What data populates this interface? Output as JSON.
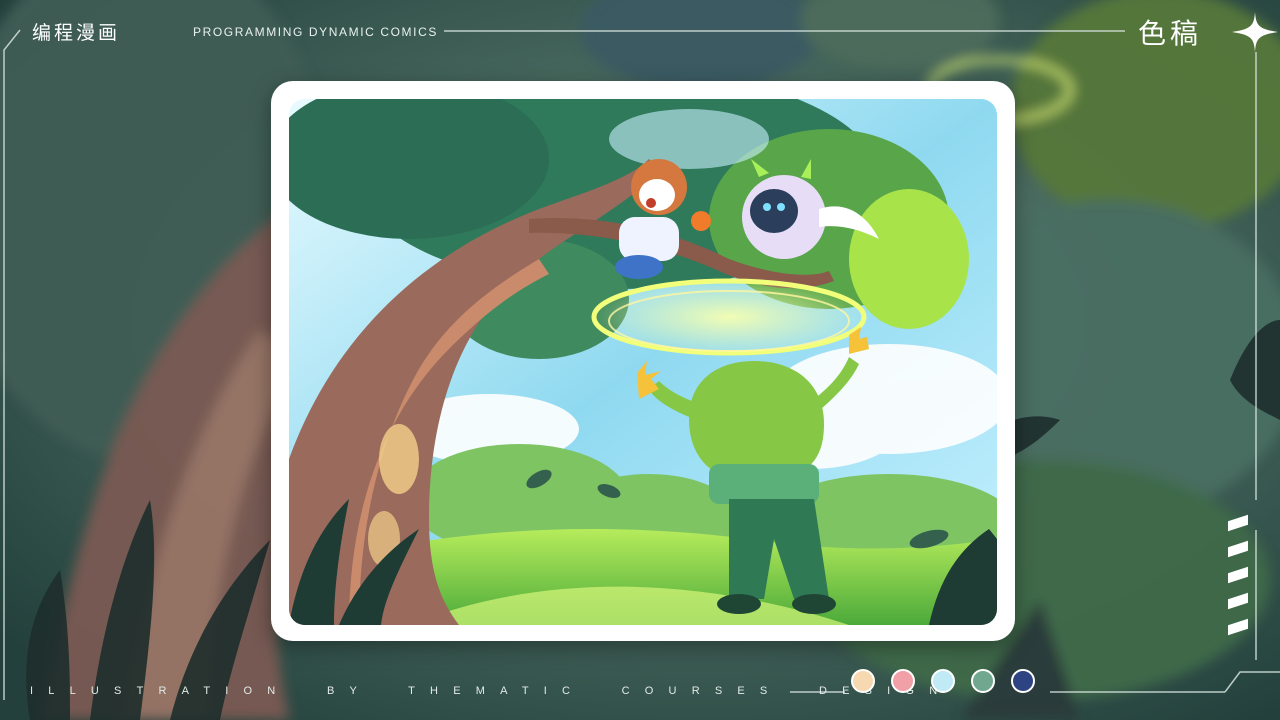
{
  "header": {
    "title": "编程漫画",
    "subtitle": "PROGRAMMING DYNAMIC COMICS",
    "badge": "色稿"
  },
  "footer": {
    "caption": "ILLUSTRATION  BY  THEMATIC  COURSES  DESIGN"
  },
  "palette": [
    "#f6d9b0",
    "#f2a0a8",
    "#bfeaf6",
    "#6fa88f",
    "#2e4382"
  ],
  "icons": [
    "sparkle-star-icon"
  ]
}
